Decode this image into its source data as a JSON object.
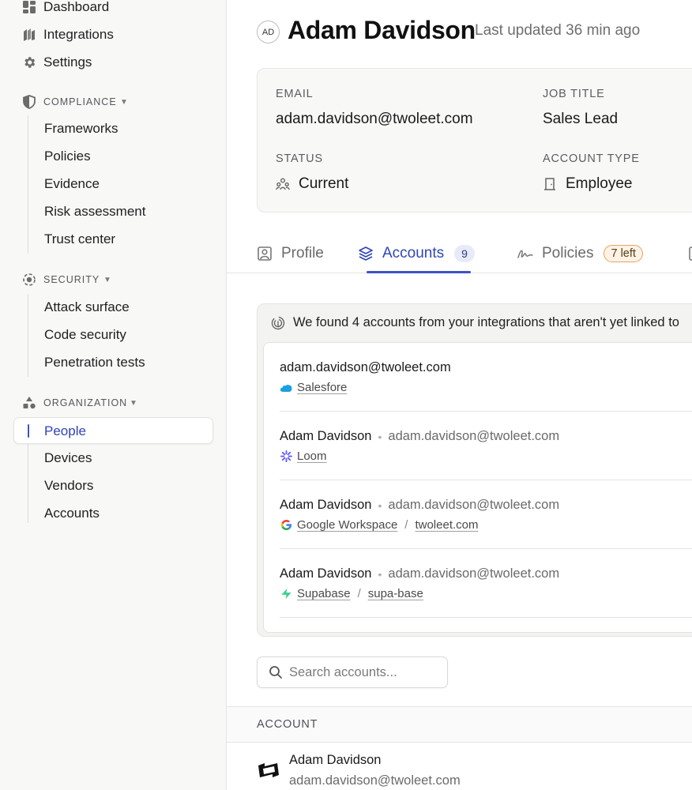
{
  "sidebar": {
    "top_items": [
      {
        "label": "Dashboard",
        "icon": "dashboard-icon"
      },
      {
        "label": "Integrations",
        "icon": "integrations-icon"
      },
      {
        "label": "Settings",
        "icon": "gear-icon"
      }
    ],
    "sections": [
      {
        "label": "COMPLIANCE",
        "icon": "shield-icon",
        "items": [
          "Frameworks",
          "Policies",
          "Evidence",
          "Risk assessment",
          "Trust center"
        ]
      },
      {
        "label": "SECURITY",
        "icon": "target-icon",
        "items": [
          "Attack surface",
          "Code security",
          "Penetration tests"
        ]
      },
      {
        "label": "ORGANIZATION",
        "icon": "shapes-icon",
        "items": [
          "People",
          "Devices",
          "Vendors",
          "Accounts"
        ],
        "active": "People"
      }
    ]
  },
  "header": {
    "avatar_initials": "AD",
    "name": "Adam Davidson",
    "updated": "Last updated 36 min ago"
  },
  "info": {
    "email_label": "EMAIL",
    "email": "adam.davidson@twoleet.com",
    "job_label": "JOB TITLE",
    "job": "Sales Lead",
    "status_label": "STATUS",
    "status": "Current",
    "status_icon": "people-icon",
    "type_label": "ACCOUNT TYPE",
    "type": "Employee",
    "type_icon": "door-icon"
  },
  "tabs": [
    {
      "label": "Profile",
      "icon": "profile-icon"
    },
    {
      "label": "Accounts",
      "icon": "layers-icon",
      "badge": "9",
      "active": true
    },
    {
      "label": "Policies",
      "icon": "signature-icon",
      "badge": "7 left"
    }
  ],
  "found": {
    "message": "We found 4 accounts from your integrations that aren't yet linked to",
    "icon": "fingerprint-icon",
    "accounts": [
      {
        "name": "",
        "email": "adam.davidson@twoleet.com",
        "sources": [
          "Salesfore"
        ],
        "source_icon": "salesforce-icon"
      },
      {
        "name": "Adam Davidson",
        "email": "adam.davidson@twoleet.com",
        "sources": [
          "Loom"
        ],
        "source_icon": "loom-icon"
      },
      {
        "name": "Adam Davidson",
        "email": "adam.davidson@twoleet.com",
        "sources": [
          "Google Workspace",
          "twoleet.com"
        ],
        "source_icon": "google-icon"
      },
      {
        "name": "Adam Davidson",
        "email": "adam.davidson@twoleet.com",
        "sources": [
          "Supabase",
          "supa-base"
        ],
        "source_icon": "supabase-icon"
      }
    ]
  },
  "search": {
    "placeholder": "Search accounts..."
  },
  "table": {
    "column_account": "ACCOUNT",
    "rows": [
      {
        "name": "Adam Davidson",
        "email": "adam.davidson@twoleet.com",
        "icon": "app-logo-icon"
      }
    ]
  },
  "colors": {
    "accent": "#3f51c8",
    "sidebar_bg": "#f8f8f7",
    "badge_orange_border": "#e9a15e"
  }
}
